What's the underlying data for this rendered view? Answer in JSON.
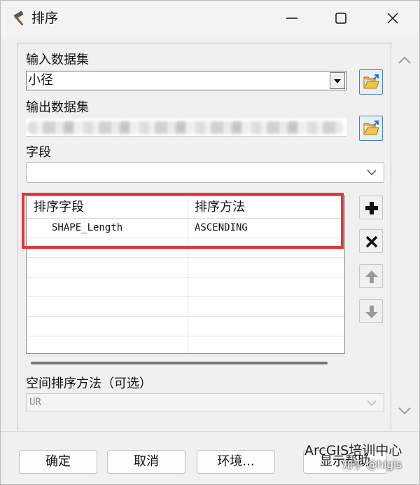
{
  "window": {
    "title": "排序",
    "controls": {
      "minimize": "minimize-icon",
      "maximize": "maximize-icon",
      "close": "close-icon"
    }
  },
  "input_dataset": {
    "label": "输入数据集",
    "value": "小径"
  },
  "output_dataset": {
    "label": "输出数据集"
  },
  "field": {
    "label": "字段",
    "value": ""
  },
  "sort_table": {
    "headers": [
      "排序字段",
      "排序方法"
    ],
    "rows": [
      [
        "SHAPE_Length",
        "ASCENDING"
      ]
    ]
  },
  "side_buttons": [
    "add-icon",
    "remove-icon",
    "move-up-icon",
    "move-down-icon"
  ],
  "spatial_sort": {
    "label": "空间排序方法（可选）",
    "value": "UR"
  },
  "buttons": {
    "ok": "确定",
    "cancel": "取消",
    "environments": "环境...",
    "show_help": "显示帮助"
  },
  "watermark": {
    "line1": "ArcGIS培训中心",
    "line2": "知乎 @higis"
  },
  "colors": {
    "highlight": "#e0373d",
    "folder_accent": "#4a7fc4"
  }
}
